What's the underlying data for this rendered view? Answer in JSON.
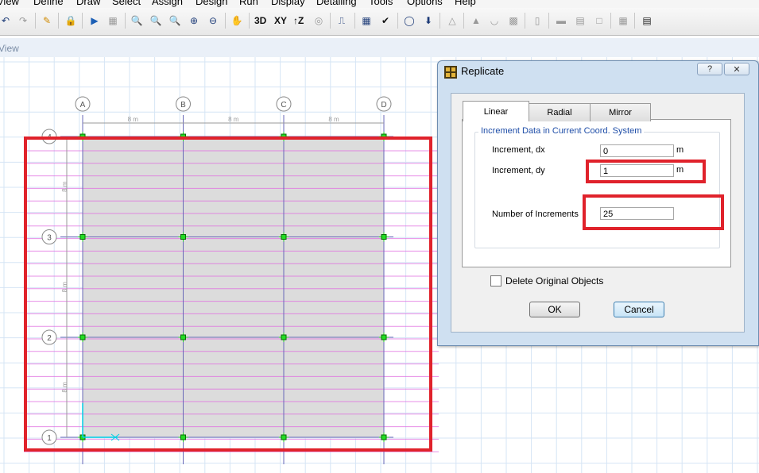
{
  "menu": [
    "View",
    "Define",
    "Draw",
    "Select",
    "Assign",
    "Design",
    "Run",
    "Display",
    "Detailing",
    "Tools",
    "Options",
    "Help"
  ],
  "toolbar": {
    "view_3d": "3D",
    "view_xy": "XY",
    "view_z": "↑Z"
  },
  "view_title": "View",
  "canvas": {
    "grid_columns": [
      "A",
      "B",
      "C",
      "D"
    ],
    "grid_rows": [
      "4",
      "3",
      "2",
      "1"
    ],
    "bay_dim_label": "8 m",
    "colors": {
      "background": "#ffffff",
      "fine_grid": "#d6e5f5",
      "slab_fill": "#dcdcdc",
      "offset_lines": "#e06ae0",
      "grid_lines": "#6a6ab8",
      "nodes": "#22dd22",
      "axis": "#00cfe6"
    }
  },
  "dialog": {
    "title": "Replicate",
    "help_button": "?",
    "close_button": "✕",
    "tabs": [
      "Linear",
      "Radial",
      "Mirror"
    ],
    "active_tab": "Linear",
    "group_title": "Increment Data in Current Coord. System",
    "dx_label": "Increment, dx",
    "dx_value": "0",
    "dx_unit": "m",
    "dy_label": "Increment, dy",
    "dy_value": "1",
    "dy_unit": "m",
    "num_label": "Number of Increments",
    "num_value": "25",
    "delete_label": "Delete Original Objects",
    "delete_checked": false,
    "ok_label": "OK",
    "cancel_label": "Cancel"
  },
  "highlight_color": "#e0222b"
}
